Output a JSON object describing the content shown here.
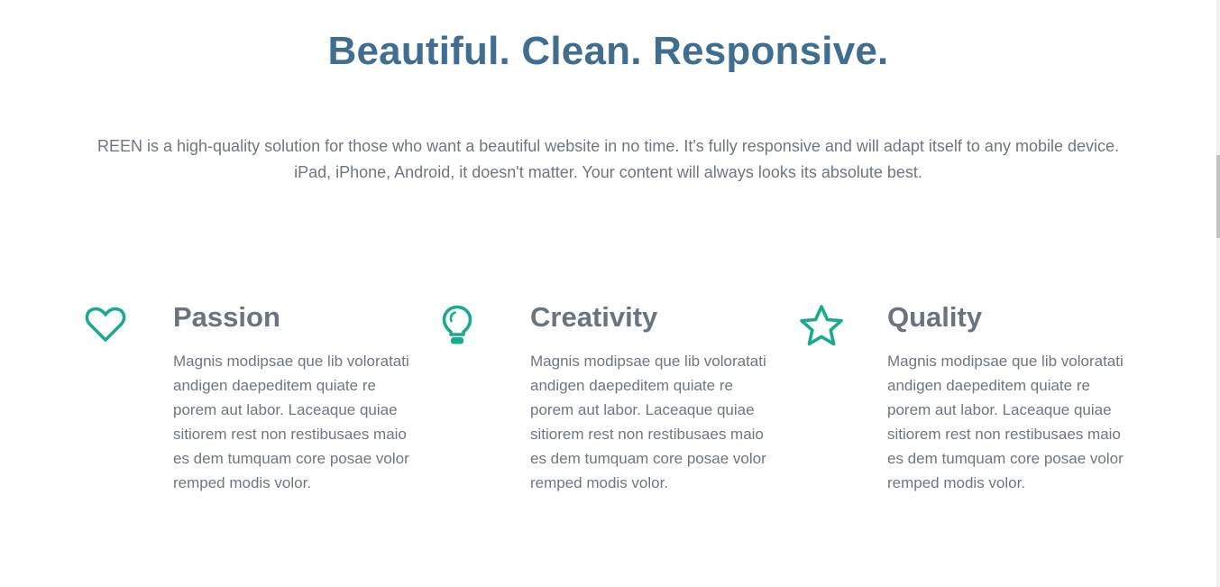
{
  "headline": "Beautiful. Clean. Responsive.",
  "intro": "REEN is a high-quality solution for those who want a beautiful website in no time. It's fully responsive and will adapt itself to any mobile device. iPad, iPhone, Android, it doesn't matter. Your content will always looks its absolute best.",
  "colors": {
    "headline": "#3f6e91",
    "icon_accent": "#1aaa8f",
    "body_text": "#6e7681"
  },
  "features": [
    {
      "icon": "heart-icon",
      "title": "Passion",
      "text": "Magnis modipsae que lib voloratati andigen daepeditem quiate re porem aut labor. Laceaque quiae sitiorem rest non restibusaes maio es dem tumquam core posae volor remped modis volor."
    },
    {
      "icon": "lightbulb-icon",
      "title": "Creativity",
      "text": "Magnis modipsae que lib voloratati andigen daepeditem quiate re porem aut labor. Laceaque quiae sitiorem rest non restibusaes maio es dem tumquam core posae volor remped modis volor."
    },
    {
      "icon": "star-icon",
      "title": "Quality",
      "text": "Magnis modipsae que lib voloratati andigen daepeditem quiate re porem aut labor. Laceaque quiae sitiorem rest non restibusaes maio es dem tumquam core posae volor remped modis volor."
    }
  ]
}
